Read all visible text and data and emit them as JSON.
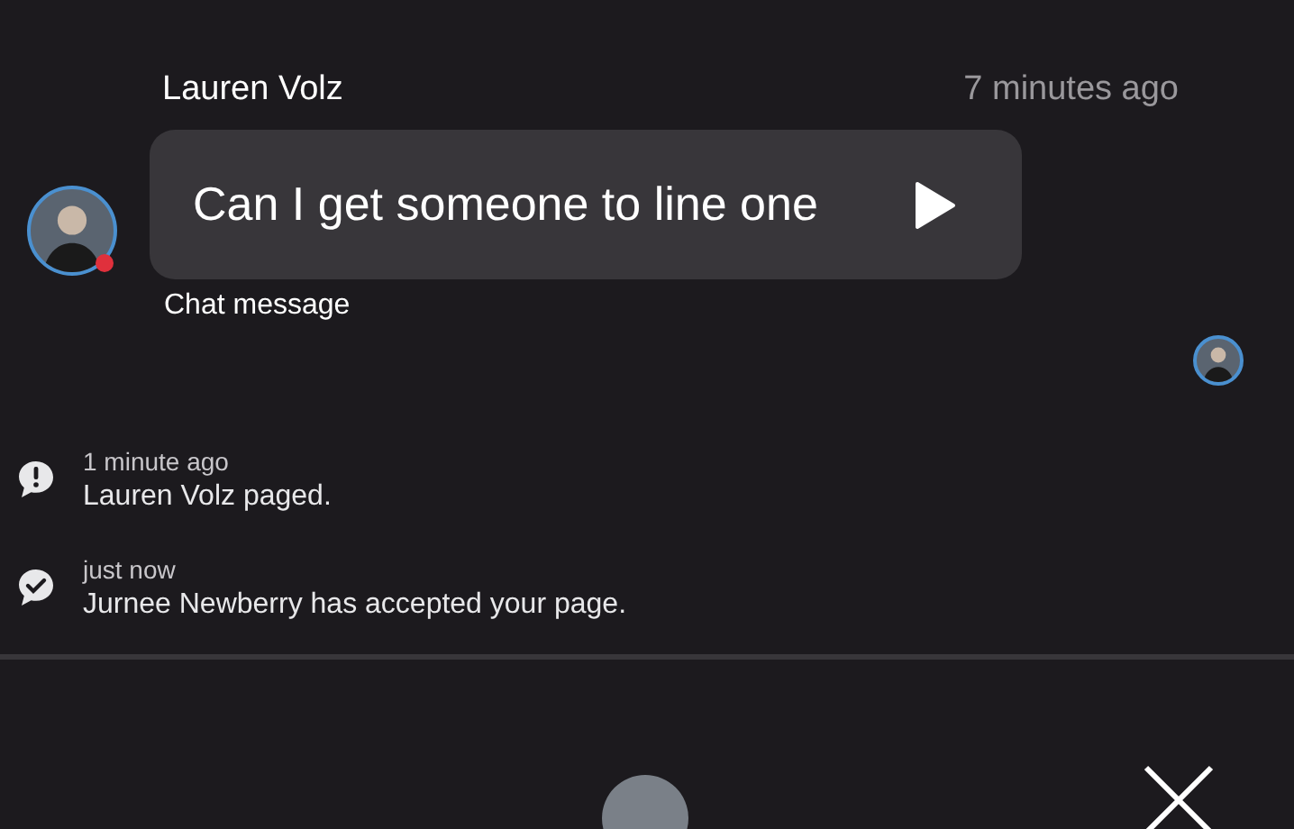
{
  "message": {
    "sender": "Lauren Volz",
    "time": "7 minutes ago",
    "text": "Can I get someone to line one",
    "caption": "Chat message",
    "sender_status": {
      "color": "#e0303c"
    }
  },
  "events": [
    {
      "kind": "alert",
      "time": "1 minute ago",
      "text": "Lauren Volz paged."
    },
    {
      "kind": "accepted",
      "time": "just now",
      "text": "Jurnee Newberry has accepted your page."
    }
  ]
}
